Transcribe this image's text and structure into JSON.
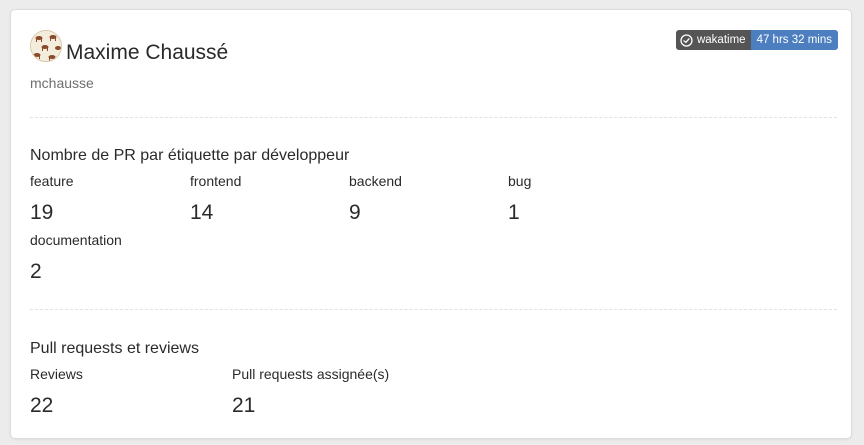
{
  "profile": {
    "name": "Maxime Chaussé",
    "username": "mchausse"
  },
  "badge": {
    "label": "wakatime",
    "value": "47 hrs 32 mins",
    "label_color": "#555555",
    "value_color": "#4c7ec0",
    "icon": "wakatime-clock-icon"
  },
  "pr_by_label": {
    "title": "Nombre de PR par étiquette par développeur",
    "stats": [
      {
        "label": "feature",
        "value": "19"
      },
      {
        "label": "frontend",
        "value": "14"
      },
      {
        "label": "backend",
        "value": "9"
      },
      {
        "label": "bug",
        "value": "1"
      },
      {
        "label": "documentation",
        "value": "2"
      }
    ]
  },
  "pulls_reviews": {
    "title": "Pull requests et reviews",
    "stats": [
      {
        "label": "Reviews",
        "value": "22"
      },
      {
        "label": "Pull requests assignée(s)",
        "value": "21"
      }
    ]
  }
}
